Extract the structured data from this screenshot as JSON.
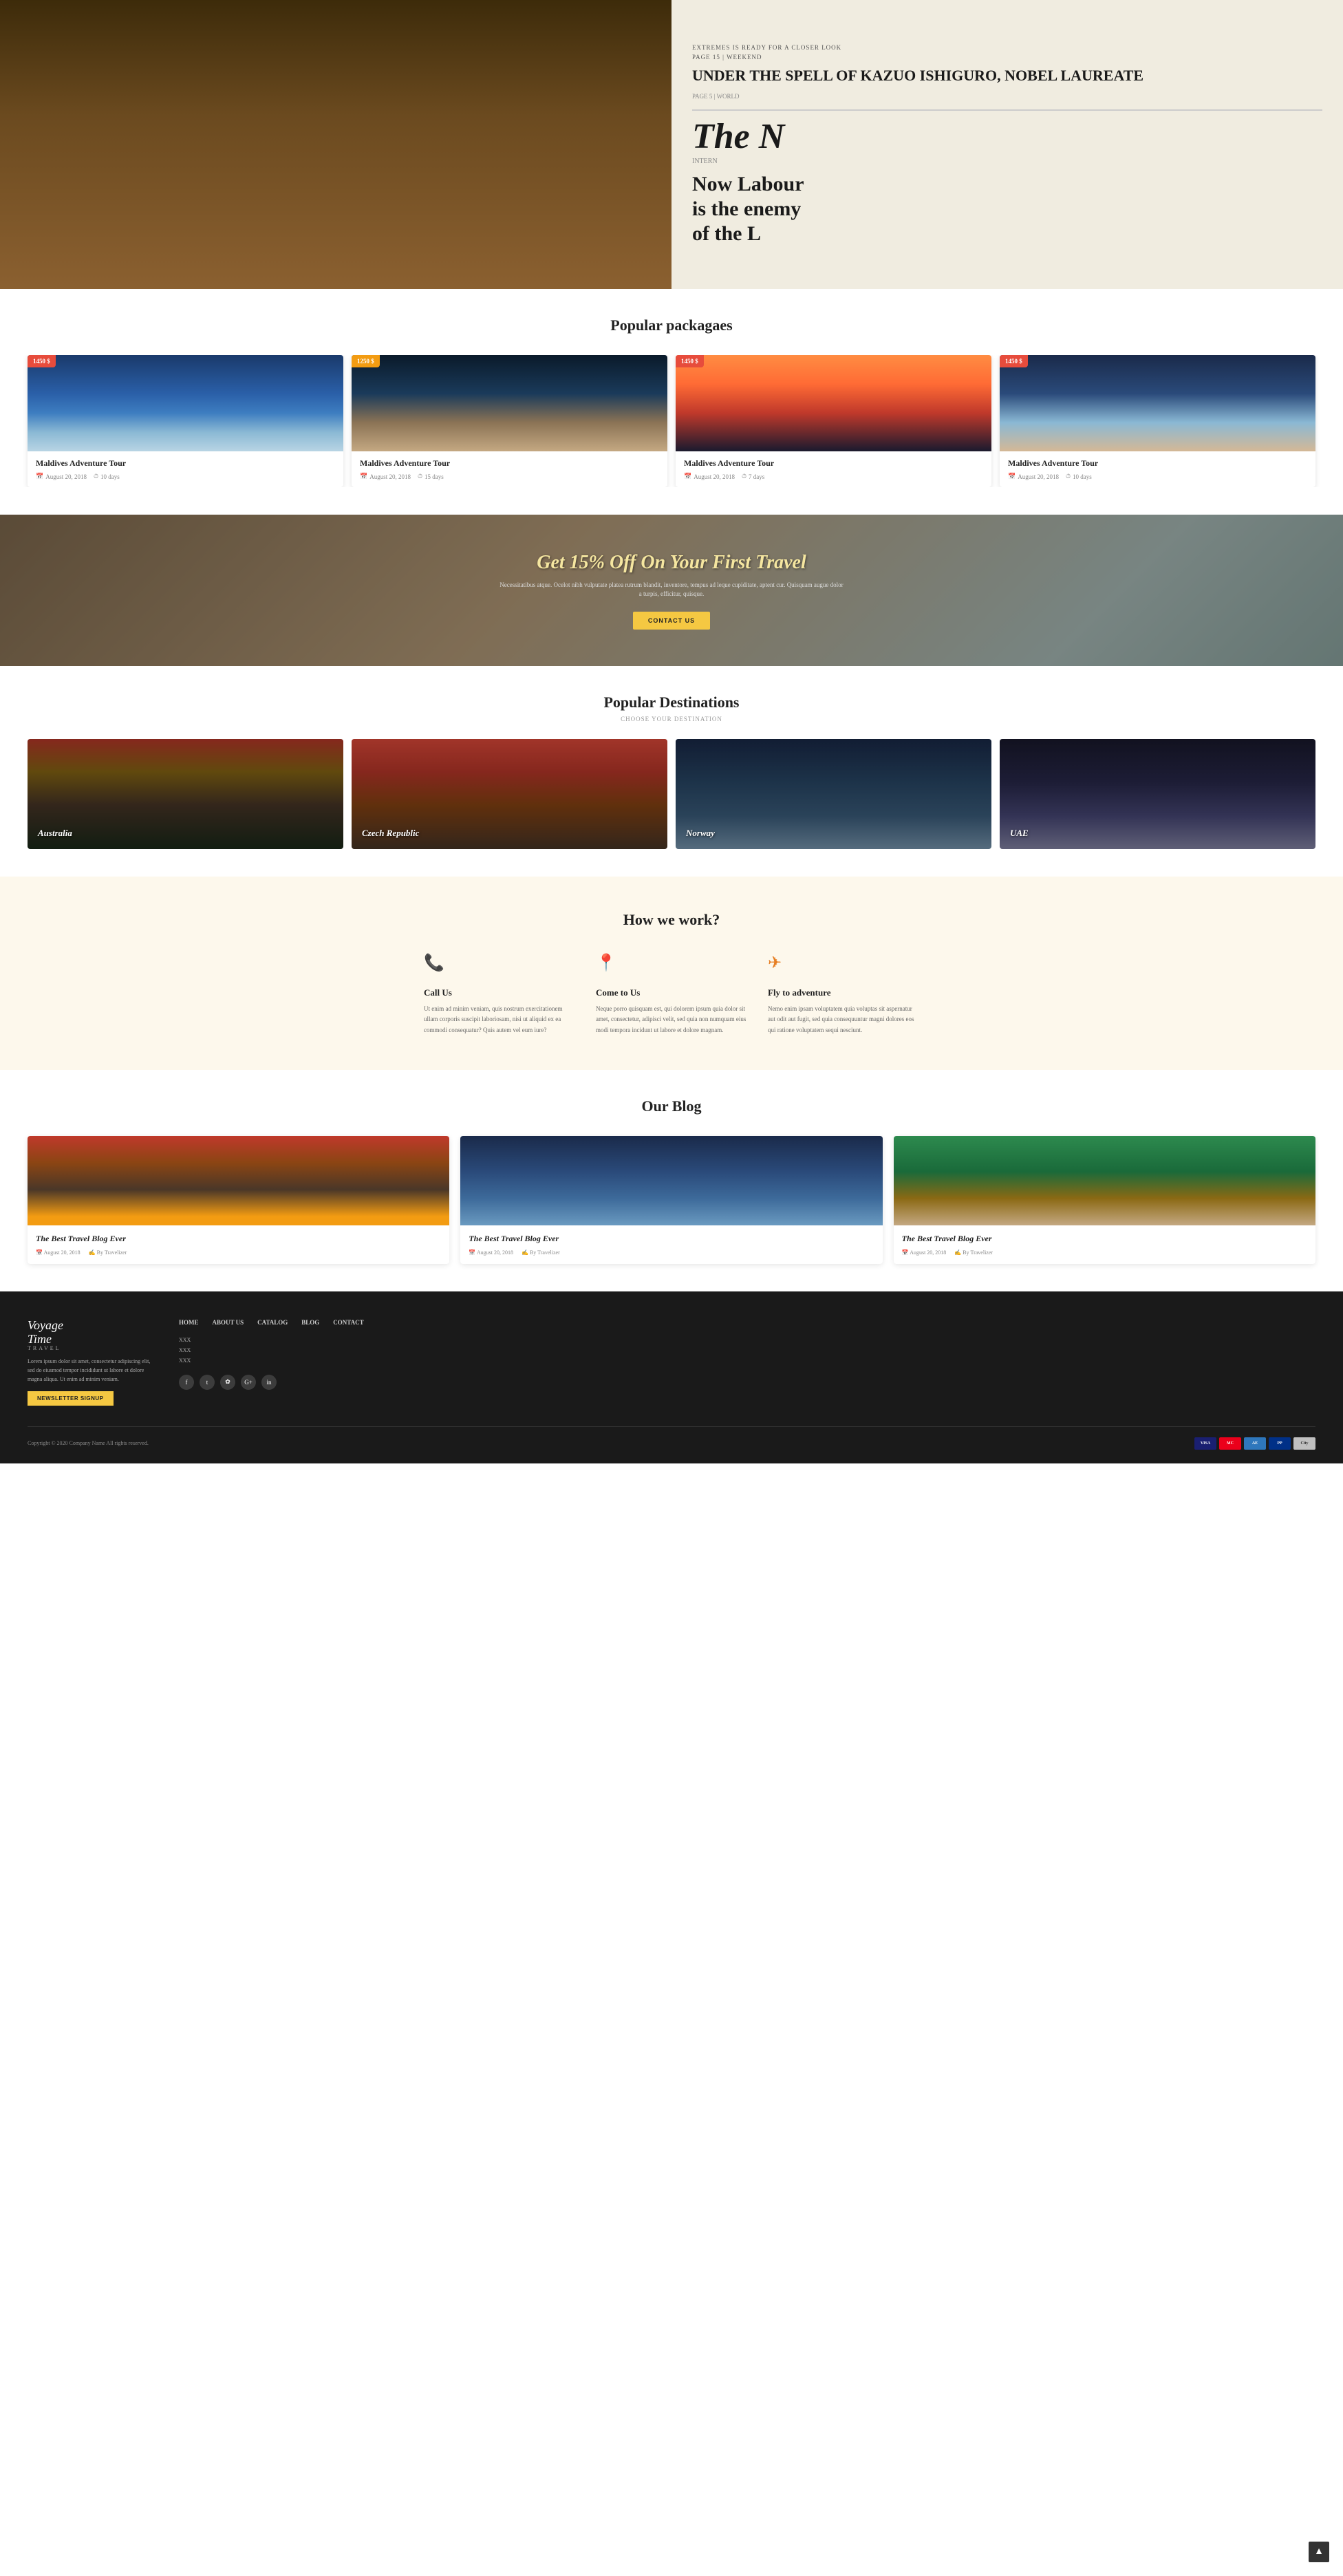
{
  "hero": {
    "newspaper_headline": "UNDER THE SPELL OF KAZUO ISHIGURO, NOBEL LAUREATE",
    "newspaper_page": "PAGE 5 | WORLD",
    "newspaper_big": "The N",
    "newspaper_inter": "INTERN",
    "newspaper_subtext": "Now Labour is the enemy of the L"
  },
  "packages": {
    "section_title": "Popular packagaes",
    "items": [
      {
        "badge": "1450 $",
        "badge_color": "red",
        "name": "Maldives Adventure Tour",
        "date": "August 20, 2018",
        "duration": "10 days",
        "img_class": "pkg-img-1"
      },
      {
        "badge": "1250 $",
        "badge_color": "yellow",
        "name": "Maldives Adventure Tour",
        "date": "August 20, 2018",
        "duration": "15 days",
        "img_class": "pkg-img-2"
      },
      {
        "badge": "1450 $",
        "badge_color": "red",
        "name": "Maldives Adventure Tour",
        "date": "August 20, 2018",
        "duration": "7 days",
        "img_class": "pkg-img-3"
      },
      {
        "badge": "1450 $",
        "badge_color": "red",
        "name": "Maldives Adventure Tour",
        "date": "August 20, 2018",
        "duration": "10 days",
        "img_class": "pkg-img-4"
      }
    ]
  },
  "promo": {
    "title": "Get 15% Off On Your First Travel",
    "subtitle": "Necessitatibus atque. Ocelot nibh vulputate platea rutrum blandit, inventore, tempus ad leque cupiditate, aptent cur. Quisquam augue dolor a turpis, efficitur, quisque.",
    "contact_btn": "CONTACT US"
  },
  "destinations": {
    "section_title": "Popular Destinations",
    "subtitle": "CHOOSE YOUR DESTINATION",
    "items": [
      {
        "name": "Australia",
        "img_class": "dest-img-1"
      },
      {
        "name": "Czech Republic",
        "img_class": "dest-img-2"
      },
      {
        "name": "Norway",
        "img_class": "dest-img-3"
      },
      {
        "name": "UAE",
        "img_class": "dest-img-4"
      }
    ]
  },
  "how": {
    "section_title": "How we work?",
    "items": [
      {
        "icon": "📞",
        "icon_name": "phone-icon",
        "title": "Call Us",
        "text": "Ut enim ad minim veniam, quis nostrum exercitationem ullam corporis suscipit laboriosam, nisi ut aliquid ex ea commodi consequatur? Quis autem vel eum iure?"
      },
      {
        "icon": "📍",
        "icon_name": "location-icon",
        "title": "Come to Us",
        "text": "Neque porro quisquam est, qui dolorem ipsum quia dolor sit amet, consectetur, adipisci velit, sed quia non numquam eius modi tempora incidunt ut labore et dolore magnam."
      },
      {
        "icon": "✈",
        "icon_name": "plane-icon",
        "title": "Fly to adventure",
        "text": "Nemo enim ipsam voluptatem quia voluptas sit aspernatur aut odit aut fugit, sed quia consequuntur magni dolores eos qui ratione voluptatem sequi nesciunt."
      }
    ]
  },
  "blog": {
    "section_title": "Our Blog",
    "items": [
      {
        "title": "The Best Travel Blog Ever",
        "date": "August 20, 2018",
        "author": "By Travelizer",
        "img_class": "blog-img-1"
      },
      {
        "title": "The Best Travel Blog Ever",
        "date": "August 20, 2018",
        "author": "By Travelizer",
        "img_class": "blog-img-2"
      },
      {
        "title": "The Best Travel Blog Ever",
        "date": "August 20, 2018",
        "author": "By Travelizer",
        "img_class": "blog-img-3"
      }
    ]
  },
  "footer": {
    "logo_line1": "Voyage",
    "logo_line2": "Time",
    "logo_sub": "TRAVEL",
    "description": "Lorem ipsum dolor sit amet, consectetur adipiscing elit, sed do eiusmod tempor incididunt ut labore et dolore magna aliqua. Ut enim ad minim veniam.",
    "newsletter_btn": "NEWSLETTER SIGNUP",
    "nav_links": [
      "HOME",
      "ABOUT US",
      "CATALOG",
      "BLOG",
      "CONTACT"
    ],
    "side_links": [
      "XXX",
      "XXX",
      "XXX"
    ],
    "social_icons": [
      "f",
      "t",
      "g+",
      "G",
      "in"
    ],
    "copyright": "Copyright © 2020 Company Name All rights reserved.",
    "payment": [
      "VISA",
      "MC",
      "AE",
      "PP",
      "CITY"
    ]
  }
}
